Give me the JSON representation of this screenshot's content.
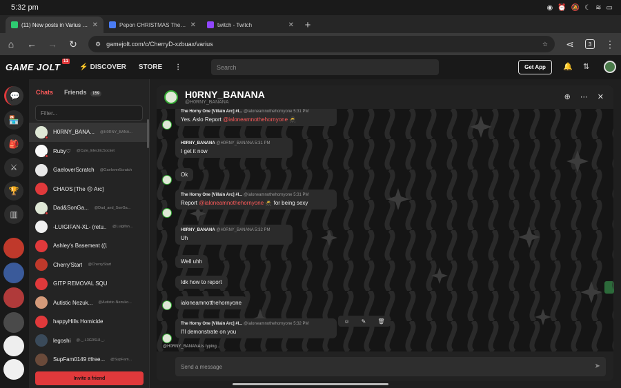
{
  "status": {
    "time": "5:32 pm"
  },
  "tabs": [
    {
      "title": "(11) New posts in Varius - The cha",
      "favicon_color": "#2ecc71"
    },
    {
      "title": "Pepon CHRISTMAS Theme - Goo",
      "favicon_color": "#4a7cf4"
    },
    {
      "title": "twitch - Twitch",
      "favicon_color": "#9146ff"
    }
  ],
  "url": "gamejolt.com/c/CherryD-xzbuax/varius",
  "tab_count": "3",
  "gj": {
    "logo": "GAME JOLT",
    "badge": "11",
    "discover": "DISCOVER",
    "store": "STORE",
    "search_placeholder": "Search",
    "get_app": "Get App"
  },
  "chatlist": {
    "tab_chats": "Chats",
    "tab_friends": "Friends",
    "friends_count": "159",
    "filter_placeholder": "Filter...",
    "invite": "Invite a friend",
    "items": [
      {
        "name": "H0RNY_BANA...",
        "handle": "@H0RNY_BANA...",
        "color": "#dfe8d6",
        "dot": true
      },
      {
        "name": "Ruby♡",
        "handle": "@Cute_ElectricSocket",
        "color": "#fafafa",
        "dot": true
      },
      {
        "name": "GaeloverScratch",
        "handle": "@GaeloverScratch",
        "color": "#e8e8e8",
        "dot": false
      },
      {
        "name": "CHAOS [The ☹ Arc]",
        "handle": "",
        "color": "#e0393b",
        "dot": false
      },
      {
        "name": "Dad&SonGa...",
        "handle": "@Dad_and_SonGa...",
        "color": "#dfe8d6",
        "dot": true
      },
      {
        "name": "-LUIGIFAN-XL- (retu...",
        "handle": "@Luigifan...",
        "color": "#f0f0f0",
        "dot": false
      },
      {
        "name": "Ashley's Basement ((LET US O...",
        "handle": "",
        "color": "#e0393b",
        "dot": false
      },
      {
        "name": "Cherry'Start",
        "handle": "@CherryStart",
        "color": "#c0392b",
        "dot": false
      },
      {
        "name": "GITP REMOVAL SQUAD",
        "handle": "",
        "color": "#e0393b",
        "dot": false
      },
      {
        "name": "Autistic Nezuk...",
        "handle": "@Autistic-Nezuko...",
        "color": "#d49a7a",
        "dot": false
      },
      {
        "name": "happyHills Homicide",
        "handle": "",
        "color": "#e0393b",
        "dot": false
      },
      {
        "name": "legoshi",
        "handle": "@-_-L3G0SHI-_-",
        "color": "#3a4a5a",
        "dot": false
      },
      {
        "name": "SupFam0149 #free...",
        "handle": "@SupFam...",
        "color": "#6a4a3a",
        "dot": false
      }
    ]
  },
  "chat": {
    "title": "H0RNY_BANANA",
    "subtitle": "@H0RNY_BANANA",
    "typing": "@H0RNY_BANANA is typing...",
    "composer_placeholder": "Send a message",
    "messages": [
      {
        "author": "The Horny One [Villain Arc] #I...",
        "handle": "@ialoneamnothehornyone",
        "time": "5:31 PM",
        "pre": "Yes. Aslo Report ",
        "mention": "@ialoneamnothehornyone",
        "post": " 🥷"
      },
      {
        "author": "H0RNY_BANANA",
        "handle": "@H0RNY_BANANA",
        "time": "5:31 PM",
        "text": "I get it now"
      },
      {
        "text": "Ok"
      },
      {
        "author": "The Horny One [Villain Arc] #I...",
        "handle": "@ialoneamnothehornyone",
        "time": "5:31 PM",
        "pre": "Report ",
        "mention": "@ialoneamnothehornyone",
        "post": " 🥷 for being sexy"
      },
      {
        "author": "H0RNY_BANANA",
        "handle": "@H0RNY_BANANA",
        "time": "5:32 PM",
        "text": "Uh"
      },
      {
        "text": "Well uhh"
      },
      {
        "text": "Idk how to report"
      },
      {
        "text": "ialoneamnotthehornyone"
      },
      {
        "author": "The Horny One [Villain Arc] #I...",
        "handle": "@ialoneamnothehornyone",
        "time": "5:32 PM",
        "text": "I'll demonstrate on you"
      }
    ]
  }
}
